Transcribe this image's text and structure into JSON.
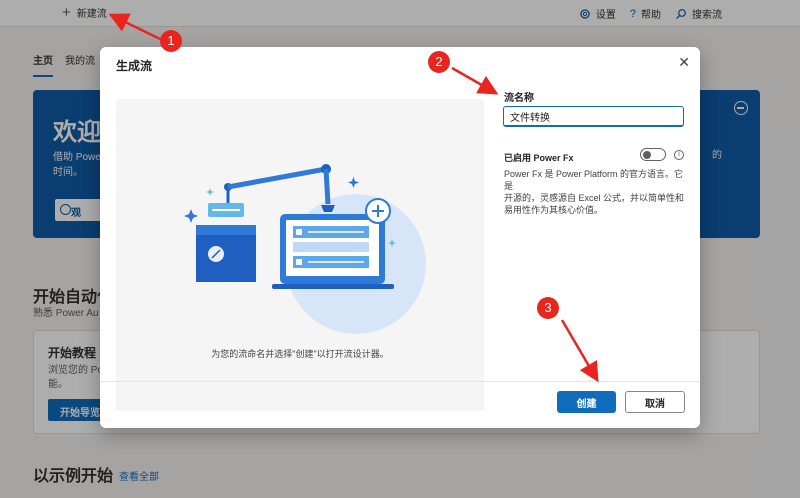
{
  "topbar": {
    "new_flow": "新建流",
    "settings": "设置",
    "help": "帮助",
    "search": "搜索流"
  },
  "tabs": [
    {
      "label": "主页",
      "active": true
    },
    {
      "label": "我的流",
      "active": false
    }
  ],
  "hero": {
    "title": "欢迎",
    "desc_line1": "借助 Powe",
    "desc_line2": "时间。",
    "button": "观",
    "right_text": "的"
  },
  "start": {
    "title": "开始自动化",
    "subtitle": "熟悉 Power Au"
  },
  "card": {
    "title": "开始教程",
    "desc_line1": "浏览您的 Po",
    "desc_line2": "能。",
    "button": "开始导览"
  },
  "examples": {
    "title": "以示例开始",
    "link": "查看全部"
  },
  "modal": {
    "title": "生成流",
    "caption": "为您的流命名并选择\"创建\"以打开流设计器。",
    "name_label": "流名称",
    "name_value": "文件转换",
    "fx_label": "已启用 Power Fx",
    "fx_enabled": false,
    "fx_desc_line1": "Power Fx 是 Power Platform 的官方语言。它是",
    "fx_desc_line2": "开源的，灵感源自 Excel 公式，并以简单性和",
    "fx_desc_line3": "易用性作为其核心价值。",
    "create": "创建",
    "cancel": "取消"
  },
  "annotations": [
    "1",
    "2",
    "3"
  ],
  "colors": {
    "accent": "#0f6cbd",
    "hero": "#0f5aa6",
    "annotation": "#e8261f"
  }
}
